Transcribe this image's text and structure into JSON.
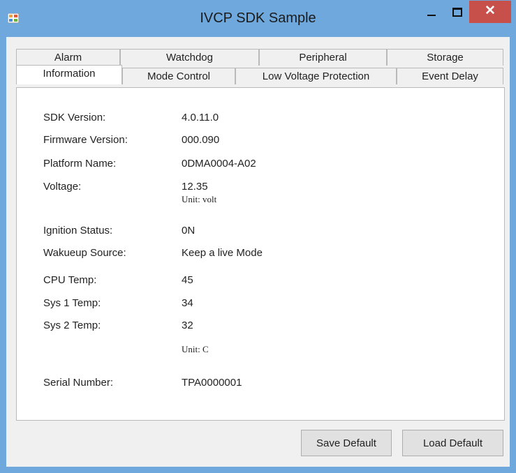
{
  "window": {
    "title": "IVCP SDK Sample",
    "close_glyph": "✕"
  },
  "tabs_row1": [
    "Alarm",
    "Watchdog",
    "Peripheral",
    "Storage"
  ],
  "tabs_row2": [
    "Information",
    "Mode Control",
    "Low Voltage Protection",
    "Event Delay"
  ],
  "selected_tab": "Information",
  "info": {
    "sdk_version_label": "SDK Version:",
    "sdk_version_value": "4.0.11.0",
    "firmware_version_label": "Firmware Version:",
    "firmware_version_value": "000.090",
    "platform_name_label": "Platform Name:",
    "platform_name_value": "0DMA0004-A02",
    "voltage_label": "Voltage:",
    "voltage_value": "12.35",
    "voltage_unit": "Unit: volt",
    "ignition_status_label": "Ignition Status:",
    "ignition_status_value": "0N",
    "wakeup_source_label": "Wakueup Source:",
    "wakeup_source_value": "Keep a live Mode",
    "cpu_temp_label": "CPU Temp:",
    "cpu_temp_value": "45",
    "sys1_temp_label": "Sys 1 Temp:",
    "sys1_temp_value": "34",
    "sys2_temp_label": "Sys 2 Temp:",
    "sys2_temp_value": "32",
    "temp_unit": "Unit: C",
    "serial_number_label": "Serial Number:",
    "serial_number_value": "TPA0000001"
  },
  "buttons": {
    "save_default": "Save Default",
    "load_default": "Load Default"
  },
  "colors": {
    "titlebar": "#6fa8dc",
    "close_button": "#c7504b",
    "face": "#f0f0f0"
  }
}
